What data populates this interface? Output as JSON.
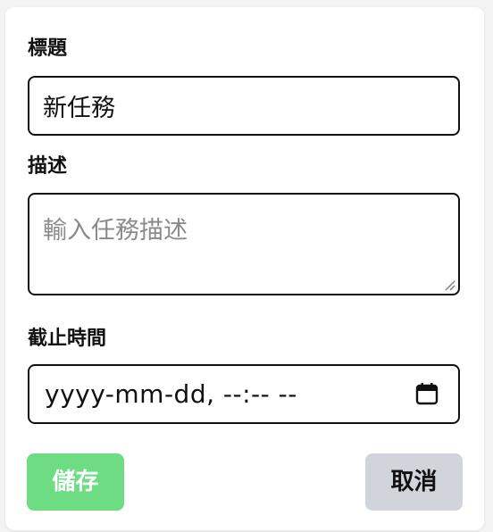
{
  "form": {
    "title_label": "標題",
    "title_value": "新任務",
    "description_label": "描述",
    "description_placeholder": "輸入任務描述",
    "description_value": "",
    "deadline_label": "截止時間",
    "deadline_display": "yyyy-mm-dd, --:-- --",
    "deadline_icon": "calendar-icon"
  },
  "actions": {
    "save_label": "儲存",
    "cancel_label": "取消"
  },
  "colors": {
    "save_bg": "#6ddc82",
    "cancel_bg": "#d1d5db",
    "border": "#111111"
  }
}
